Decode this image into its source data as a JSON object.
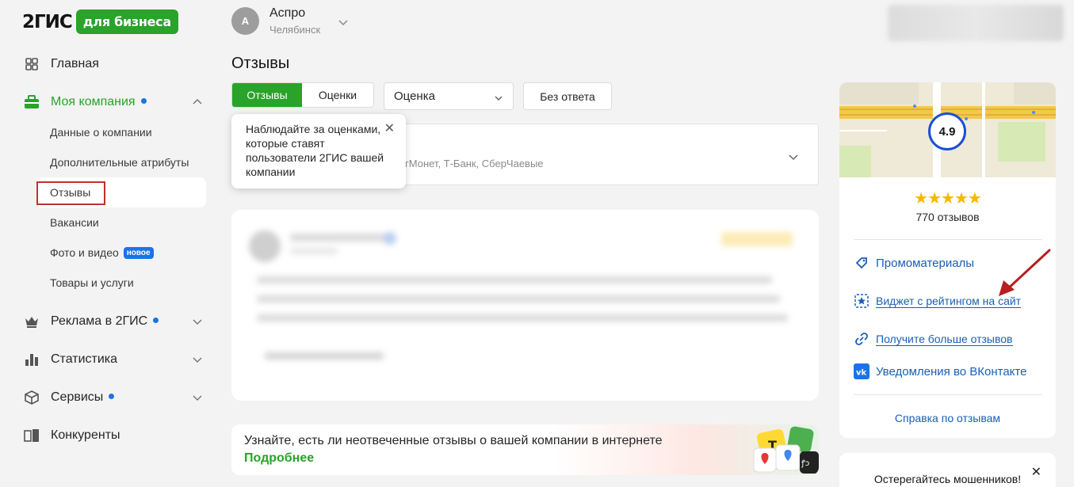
{
  "logo": {
    "main": "2ГИС",
    "badge": "для бизнеса"
  },
  "company": {
    "avatar_letter": "А",
    "name": "Аспро",
    "city": "Челябинск"
  },
  "sidebar": {
    "main": "Главная",
    "my_company": "Моя компания",
    "sub": [
      "Данные о компании",
      "Дополнительные атрибуты",
      "Отзывы",
      "Вакансии",
      "Фото и видео",
      "Товары и услуги"
    ],
    "new_badge": "новое",
    "ads": "Реклама в 2ГИС",
    "stats": "Статистика",
    "services": "Сервисы",
    "competitors": "Конкуренты"
  },
  "page": {
    "title": "Отзывы"
  },
  "filters": {
    "tab_reviews": "Отзывы",
    "tab_ratings": "Оценки",
    "select_value": "Оценка",
    "no_answer": "Без ответа"
  },
  "sources": {
    "text": "гМонет, Т-Банк, СберЧаевые"
  },
  "tooltip": {
    "text": "Наблюдайте за оценками, которые ставят пользователи 2ГИС вашей компании"
  },
  "promo": {
    "text": "Узнайте, есть ли неотвеченные отзывы о вашей компании в интернете",
    "link": "Подробнее"
  },
  "right_panel": {
    "rating": "4.9",
    "stars": "★★★★★",
    "reviews_count": "770 отзывов",
    "links": {
      "promo": "Промоматериалы",
      "widget": "Виджет с рейтингом на сайт",
      "more_reviews": "Получите больше отзывов",
      "vk": "Уведомления во ВКонтакте"
    },
    "help": "Справка по отзывам"
  },
  "warning": {
    "text": "Остерегайтесь мошенников!"
  },
  "colors": {
    "brand_green": "#29a329",
    "link_blue": "#1a5fb4",
    "star": "#f5b800",
    "annotation_red": "#c0302a"
  }
}
